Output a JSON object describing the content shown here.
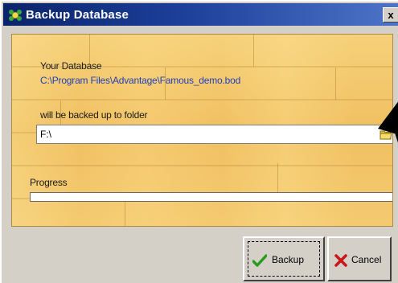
{
  "window": {
    "title": "Backup Database",
    "close_glyph": "x"
  },
  "panel": {
    "database_label": "Your Database",
    "database_path": "C:\\Program Files\\Advantage\\Famous_demo.bod",
    "folder_label": "will be backed up to folder",
    "folder_value": "F:\\",
    "progress_label": "Progress",
    "progress_value": 0
  },
  "buttons": {
    "backup_label": "Backup",
    "cancel_label": "Cancel"
  },
  "icons": {
    "app": "app-icon",
    "browse": "folder-icon",
    "backup": "checkmark-icon",
    "cancel": "x-icon"
  },
  "colors": {
    "titlebar": "#0a246a",
    "path_text": "#1f3fb8",
    "wood": "#f3c766",
    "check": "#2a9a1e",
    "cancel_x": "#c81818"
  }
}
